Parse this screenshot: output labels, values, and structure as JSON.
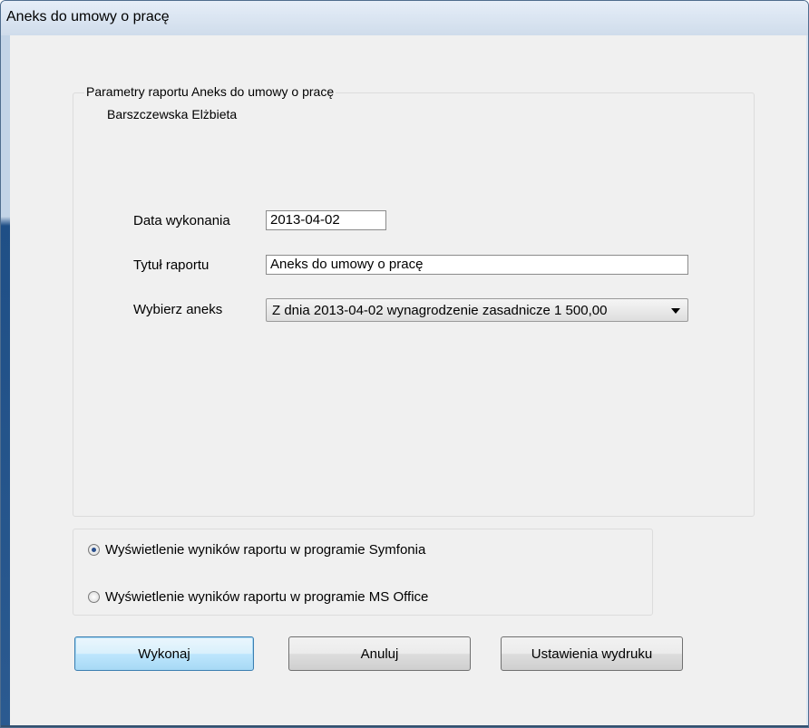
{
  "window": {
    "title": "Aneks do umowy o pracę"
  },
  "params": {
    "group_label": "Parametry raportu  Aneks do umowy o pracę",
    "person": "Barszczewska Elżbieta",
    "date_label": "Data wykonania",
    "date_value": "2013-04-02",
    "title_label": "Tytuł raportu",
    "title_value": "Aneks do umowy o pracę",
    "annex_label": "Wybierz aneks",
    "annex_value": "Z dnia 2013-04-02 wynagrodzenie zasadnicze 1 500,00"
  },
  "output": {
    "option1": "Wyświetlenie wyników raportu w programie Symfonia",
    "option2": "Wyświetlenie wyników raportu w programie MS Office",
    "selected": "option1"
  },
  "buttons": {
    "execute": "Wykonaj",
    "cancel": "Anuluj",
    "print_settings": "Ustawienia wydruku"
  }
}
